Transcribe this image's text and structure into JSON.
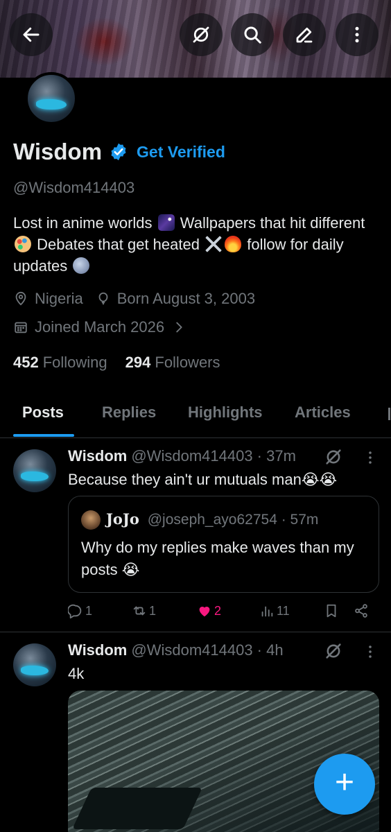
{
  "profile": {
    "name": "Wisdom",
    "get_verified": "Get Verified",
    "handle": "@Wisdom414403",
    "bio_parts": {
      "a": "Lost in anime worlds",
      "b": "Wallpapers that hit different",
      "c": "Debates that get heated",
      "d": "follow for daily updates"
    },
    "location": "Nigeria",
    "birthday": "Born August 3, 2003",
    "joined": "Joined March 2026",
    "following_count": "452",
    "following_label": "Following",
    "followers_count": "294",
    "followers_label": "Followers"
  },
  "tabs": [
    "Posts",
    "Replies",
    "Highlights",
    "Articles"
  ],
  "active_tab": "Posts",
  "posts": [
    {
      "name": "Wisdom",
      "handle": "@Wisdom414403 · 37m",
      "text": "Because they ain't ur mutuals man😭😭",
      "quote": {
        "name": "JoJo",
        "handle": "@joseph_ayo62754 · 57m",
        "text": "Why do my replies make waves than my posts 😭"
      },
      "replies": "1",
      "reposts": "1",
      "likes": "2",
      "views": "11"
    },
    {
      "name": "Wisdom",
      "handle": "@Wisdom414403 · 4h",
      "text": "4k"
    }
  ],
  "colors": {
    "accent": "#1d9bf0",
    "like": "#f91880",
    "muted": "#71767b",
    "border": "#2f3336"
  },
  "icons": [
    "back-arrow-icon",
    "grok-icon",
    "search-icon",
    "edit-icon",
    "more-vertical-icon",
    "verified-badge-icon",
    "location-pin-icon",
    "balloon-icon",
    "calendar-icon",
    "chevron-right-icon",
    "reply-icon",
    "repost-icon",
    "heart-icon",
    "views-icon",
    "bookmark-icon",
    "share-icon",
    "plus-icon"
  ]
}
